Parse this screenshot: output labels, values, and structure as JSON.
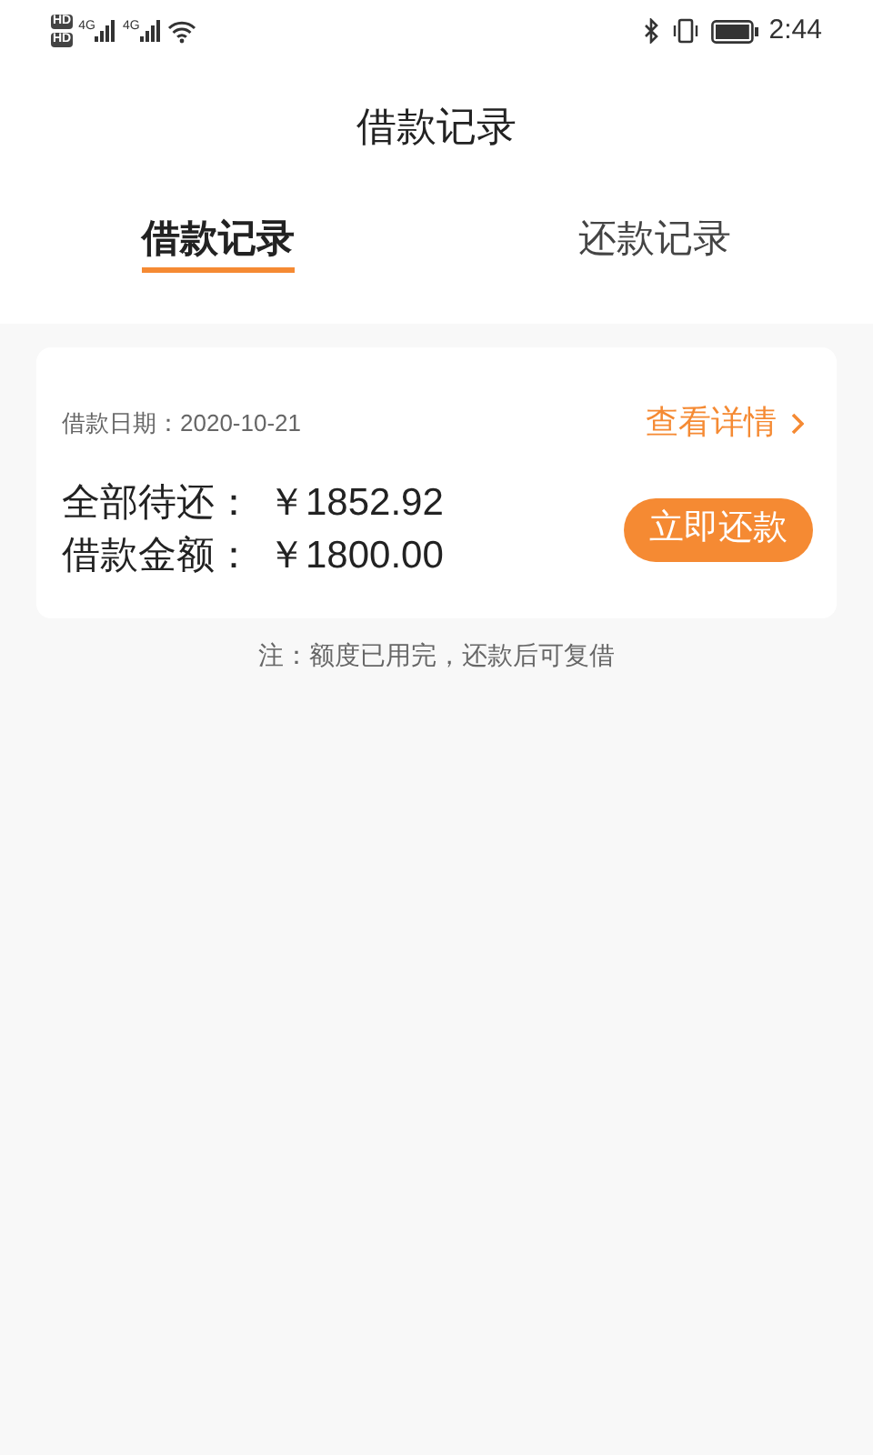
{
  "status_bar": {
    "sim_badges": [
      "HD",
      "HD"
    ],
    "networks": [
      "4G",
      "4G"
    ],
    "time": "2:44"
  },
  "title": "借款记录",
  "tabs": [
    {
      "label": "借款记录",
      "selected": true
    },
    {
      "label": "还款记录",
      "selected": false
    }
  ],
  "loan": {
    "date_label": "借款日期：2020-10-21",
    "details_link": "查看详情",
    "rows": [
      {
        "label": "全部待还：",
        "value": "￥1852.92"
      },
      {
        "label": "借款金额：",
        "value": "￥1800.00"
      }
    ],
    "repay_button": "立即还款"
  },
  "note": "注：额度已用完，还款后可复借"
}
